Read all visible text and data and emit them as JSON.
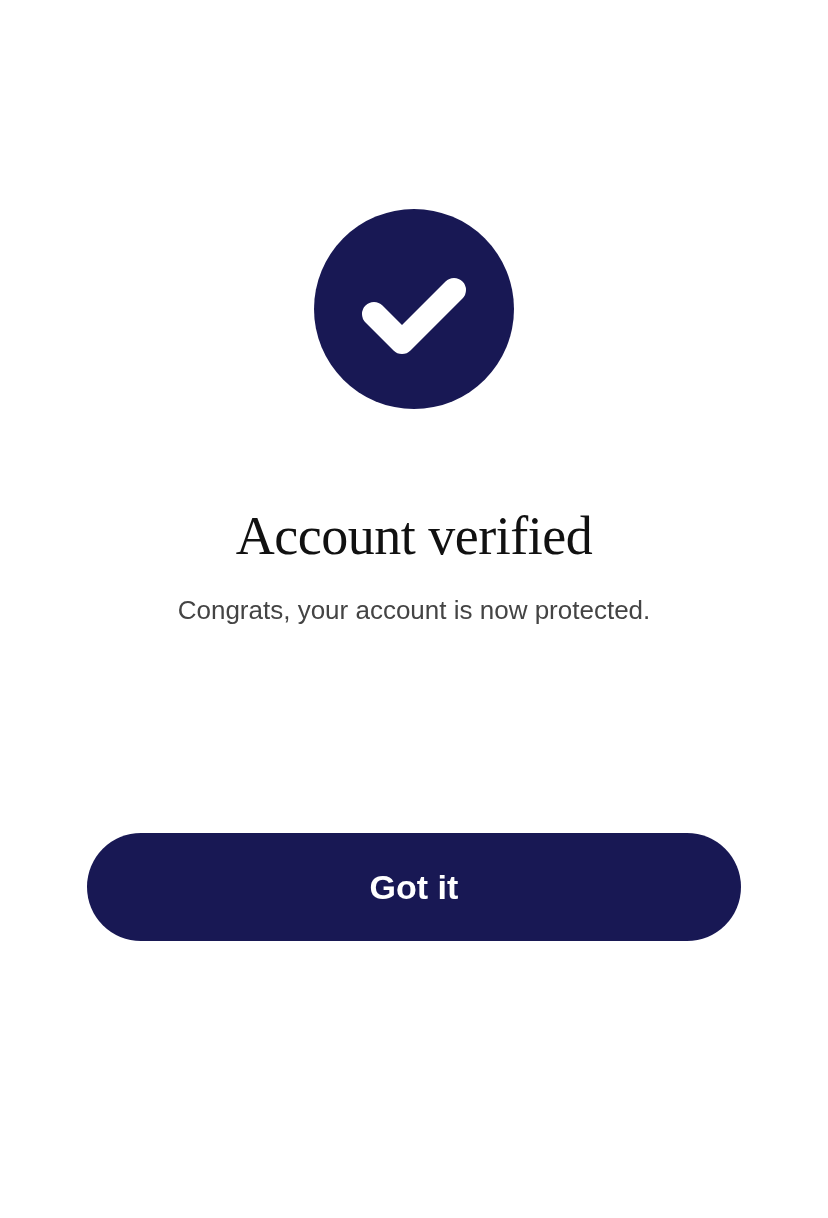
{
  "status_icon": {
    "kind": "success"
  },
  "title": "Account verified",
  "message": "Congrats, your account is now protected.",
  "button": {
    "label": "Got it"
  }
}
